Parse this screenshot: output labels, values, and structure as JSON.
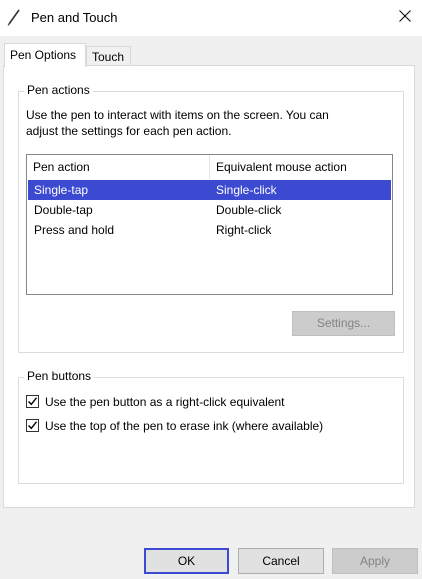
{
  "window": {
    "title": "Pen and Touch",
    "icon": "pen-icon",
    "close_icon": "close-icon"
  },
  "tabs": [
    {
      "label": "Pen Options",
      "active": true
    },
    {
      "label": "Touch",
      "active": false
    }
  ],
  "pen_actions": {
    "group_label": "Pen actions",
    "description_line1": "Use the pen to interact with items on the screen.  You can",
    "description_line2": "adjust the settings for each pen action.",
    "columns": [
      "Pen action",
      "Equivalent mouse action"
    ],
    "rows": [
      {
        "action": "Single-tap",
        "mouse": "Single-click",
        "selected": true
      },
      {
        "action": "Double-tap",
        "mouse": "Double-click",
        "selected": false
      },
      {
        "action": "Press and hold",
        "mouse": "Right-click",
        "selected": false
      }
    ],
    "settings_button": "Settings...",
    "settings_enabled": false
  },
  "pen_buttons": {
    "group_label": "Pen buttons",
    "options": [
      {
        "label": "Use the pen button as a right-click equivalent",
        "checked": true
      },
      {
        "label": "Use the top of the pen to erase ink (where available)",
        "checked": true
      }
    ]
  },
  "footer": {
    "ok": "OK",
    "cancel": "Cancel",
    "apply": "Apply",
    "apply_enabled": false
  },
  "colors": {
    "selection": "#3b4ad1",
    "default_button_border": "#3b4ad1"
  }
}
